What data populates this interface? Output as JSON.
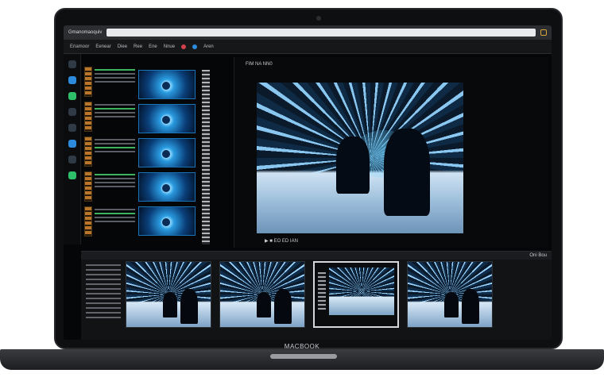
{
  "device": {
    "brand_label": "MACBOOK"
  },
  "browser": {
    "tab_title": "Gmanomaoquiv"
  },
  "toolbar": {
    "items": [
      "Eriamoor",
      "Eenear",
      "Diee",
      "Ree",
      "Ene",
      "Nnue",
      "Aren"
    ],
    "status_colors": [
      "#d2404a",
      "#2c8bdc"
    ]
  },
  "preview": {
    "header": "FIM NA  NN0",
    "controls": "▶  ■  EO ED IAN"
  },
  "timeline": {
    "corner_label": "Oni Bou"
  }
}
